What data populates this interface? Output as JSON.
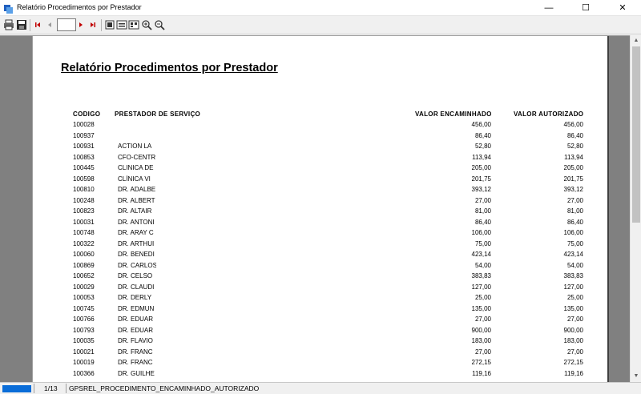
{
  "window": {
    "title": "Relatório Procedimentos por Prestador",
    "controls": {
      "minimize": "—",
      "maximize": "☐",
      "close": "✕"
    }
  },
  "toolbar": {
    "page_value": "",
    "buttons": [
      "print-icon",
      "save-icon",
      "first-page-icon",
      "previous-page-icon",
      "next-page-icon",
      "last-page-icon",
      "whole-page-icon",
      "page-width-icon",
      "multiple-pages-icon",
      "zoom-in-icon",
      "zoom-out-icon"
    ]
  },
  "report": {
    "title": "Relatório Procedimentos por Prestador",
    "columns": {
      "code": "CODIGO",
      "provider": "PRESTADOR DE SERVIÇO",
      "forwarded": "VALOR ENCAMINHADO",
      "authorized": "VALOR AUTORIZADO"
    },
    "rows": [
      {
        "code": "100028",
        "provider": "",
        "forwarded": "456,00",
        "authorized": "456,00"
      },
      {
        "code": "100937",
        "provider": "",
        "forwarded": "86,40",
        "authorized": "86,40"
      },
      {
        "code": "100931",
        "provider": " ACTION LA",
        "forwarded": "52,80",
        "authorized": "52,80"
      },
      {
        "code": "100853",
        "provider": "CFO-CENTR",
        "forwarded": "113,94",
        "authorized": "113,94"
      },
      {
        "code": "100445",
        "provider": "CLINICA DE",
        "forwarded": "205,00",
        "authorized": "205,00"
      },
      {
        "code": "100598",
        "provider": "CLÍNICA VI",
        "forwarded": "201,75",
        "authorized": "201,75"
      },
      {
        "code": "100810",
        "provider": "DR. ADALBE",
        "forwarded": "393,12",
        "authorized": "393,12"
      },
      {
        "code": "100248",
        "provider": "DR. ALBERT",
        "forwarded": "27,00",
        "authorized": "27,00"
      },
      {
        "code": "100823",
        "provider": "DR. ALTAIR",
        "forwarded": "81,00",
        "authorized": "81,00"
      },
      {
        "code": "100031",
        "provider": "DR. ANTONI",
        "forwarded": "86,40",
        "authorized": "86,40"
      },
      {
        "code": "100748",
        "provider": "DR. ARAY  C",
        "forwarded": "106,00",
        "authorized": "106,00"
      },
      {
        "code": "100322",
        "provider": "DR. ARTHUI",
        "forwarded": "75,00",
        "authorized": "75,00"
      },
      {
        "code": "100060",
        "provider": "DR. BENEDI",
        "forwarded": "423,14",
        "authorized": "423,14"
      },
      {
        "code": "100869",
        "provider": "DR. CARLOS",
        "forwarded": "54,00",
        "authorized": "54,00"
      },
      {
        "code": "100652",
        "provider": "DR. CELSO",
        "forwarded": "383,83",
        "authorized": "383,83"
      },
      {
        "code": "100029",
        "provider": "DR. CLAUDI",
        "forwarded": "127,00",
        "authorized": "127,00"
      },
      {
        "code": "100053",
        "provider": "DR. DERLY",
        "forwarded": "25,00",
        "authorized": "25,00"
      },
      {
        "code": "100745",
        "provider": "DR. EDMUN",
        "forwarded": "135,00",
        "authorized": "135,00"
      },
      {
        "code": "100766",
        "provider": "DR. EDUAR",
        "forwarded": "27,00",
        "authorized": "27,00"
      },
      {
        "code": "100793",
        "provider": "DR. EDUAR",
        "forwarded": "900,00",
        "authorized": "900,00"
      },
      {
        "code": "100035",
        "provider": "DR. FLAVIO",
        "forwarded": "183,00",
        "authorized": "183,00"
      },
      {
        "code": "100021",
        "provider": "DR. FRANC",
        "forwarded": "27,00",
        "authorized": "27,00"
      },
      {
        "code": "100019",
        "provider": "DR. FRANC",
        "forwarded": "272,15",
        "authorized": "272,15"
      },
      {
        "code": "100366",
        "provider": "DR. GUILHE",
        "forwarded": "119,16",
        "authorized": "119,16"
      }
    ]
  },
  "status": {
    "page": "1/13",
    "report_name": "GPSREL_PROCEDIMENTO_ENCAMINHADO_AUTORIZADO"
  },
  "colors": {
    "progress": "#0a6dd8",
    "preview_background": "#808080",
    "nav_arrows": "#c00000"
  }
}
